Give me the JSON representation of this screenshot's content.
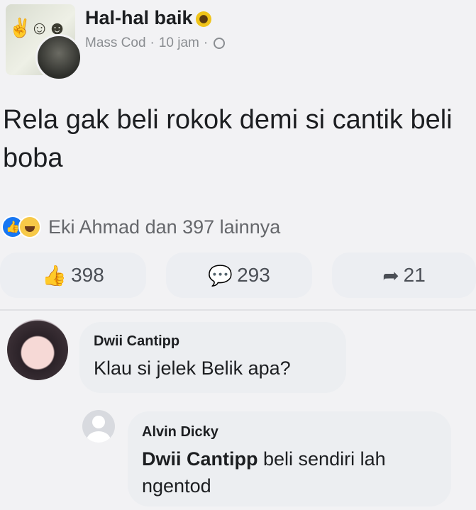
{
  "post": {
    "group_name": "Hal-hal baik",
    "author": "Mass Cod",
    "time": "10 jam",
    "separator": "·",
    "text": "Rela gak beli rokok demi si cantik beli boba",
    "reactions_summary": "Eki Ahmad dan 397 lainnya",
    "actions": {
      "like_count": "398",
      "comment_count": "293",
      "share_count": "21"
    }
  },
  "comments": [
    {
      "author": "Dwii Cantipp",
      "text": "Klau si jelek Belik apa?"
    },
    {
      "author": "Alvin Dicky",
      "mention": "Dwii Cantipp",
      "text": " beli sendiri lah ngentod"
    }
  ],
  "colors": {
    "like_blue": "#1877f2",
    "haha_yellow": "#f7c948",
    "meta_gray": "#8a8d91"
  },
  "icons": [
    "sunflower-icon",
    "globe-icon",
    "like-reaction-icon",
    "haha-reaction-icon",
    "thumbs-up-icon",
    "comment-icon",
    "share-icon",
    "default-avatar-icon"
  ]
}
